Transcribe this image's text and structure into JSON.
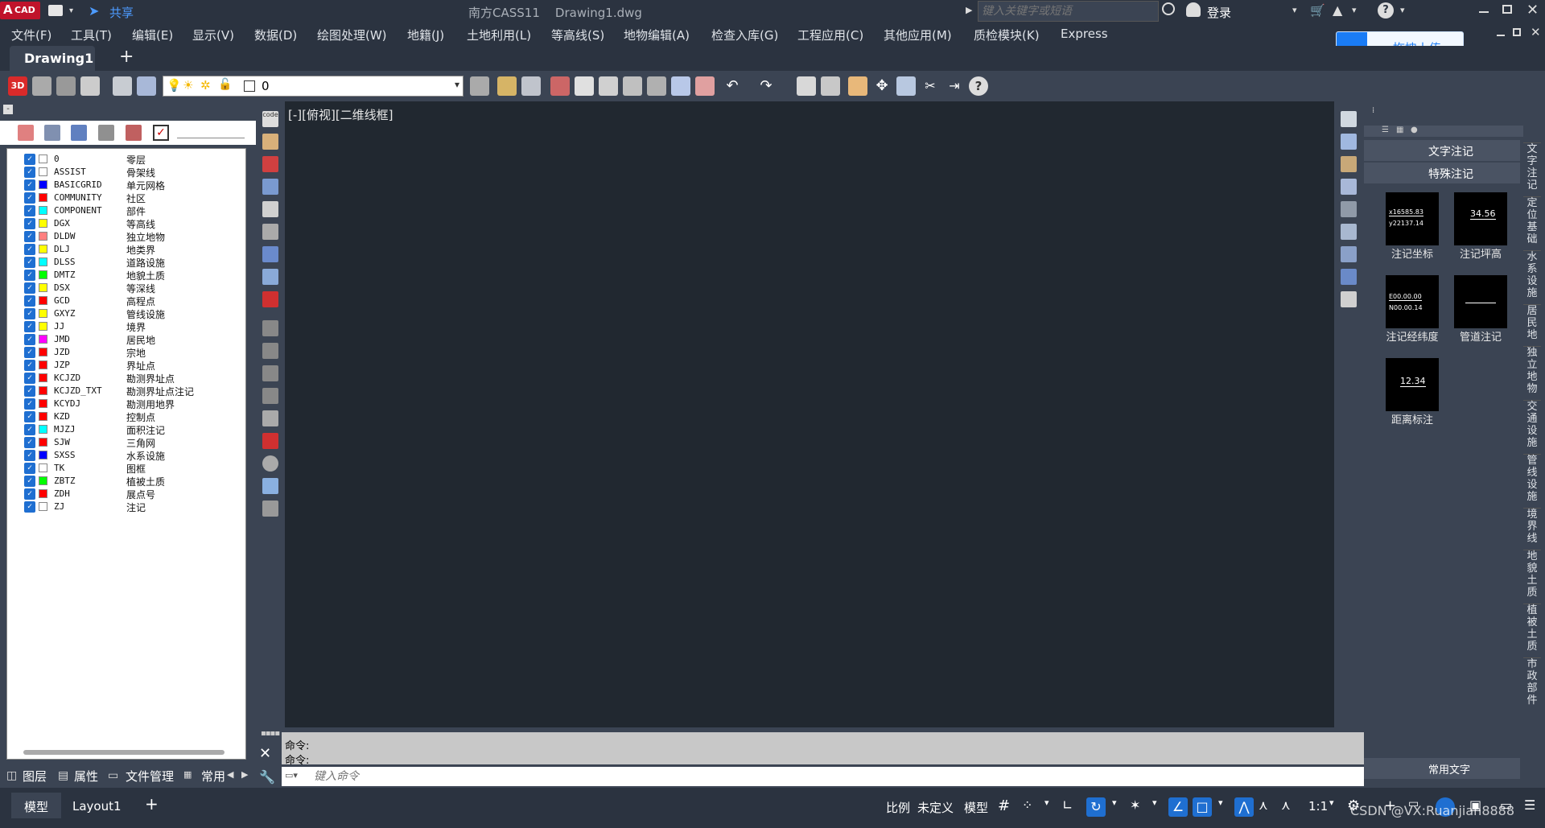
{
  "titlebar": {
    "logo_a": "A",
    "logo_cad": "CAD",
    "share": "共享",
    "title": "南方CASS11    Drawing1.dwg",
    "search_placeholder": "键入关键字或短语",
    "login": "登录"
  },
  "menu": [
    "文件(F)",
    "工具(T)",
    "编辑(E)",
    "显示(V)",
    "数据(D)",
    "绘图处理(W)",
    "地籍(J)",
    "土地利用(L)",
    "等高线(S)",
    "地物编辑(A)",
    "检查入库(G)",
    "工程应用(C)",
    "其他应用(M)",
    "质检模块(K)",
    "Express"
  ],
  "upload_button": "拖拽上传",
  "tabs": {
    "active": "Drawing1",
    "add": "+"
  },
  "toolbar": {
    "layer_value": "0"
  },
  "viewport_label": "[-][俯视][二维线框]",
  "layers": [
    {
      "name": "0",
      "desc": "零层",
      "color": "#ffffff"
    },
    {
      "name": "ASSIST",
      "desc": "骨架线",
      "color": "#ffffff"
    },
    {
      "name": "BASICGRID",
      "desc": "单元网格",
      "color": "#0000ff"
    },
    {
      "name": "COMMUNITY",
      "desc": "社区",
      "color": "#ff0000"
    },
    {
      "name": "COMPONENT",
      "desc": "部件",
      "color": "#00ffff"
    },
    {
      "name": "DGX",
      "desc": "等高线",
      "color": "#ffff00"
    },
    {
      "name": "DLDW",
      "desc": "独立地物",
      "color": "#ff8080"
    },
    {
      "name": "DLJ",
      "desc": "地类界",
      "color": "#ffff00"
    },
    {
      "name": "DLSS",
      "desc": "道路设施",
      "color": "#00ffff"
    },
    {
      "name": "DMTZ",
      "desc": "地貌土质",
      "color": "#00ff00"
    },
    {
      "name": "DSX",
      "desc": "等深线",
      "color": "#ffff00"
    },
    {
      "name": "GCD",
      "desc": "高程点",
      "color": "#ff0000"
    },
    {
      "name": "GXYZ",
      "desc": "管线设施",
      "color": "#ffff00"
    },
    {
      "name": "JJ",
      "desc": "境界",
      "color": "#ffff00"
    },
    {
      "name": "JMD",
      "desc": "居民地",
      "color": "#ff00ff"
    },
    {
      "name": "JZD",
      "desc": "宗地",
      "color": "#ff0000"
    },
    {
      "name": "JZP",
      "desc": "界址点",
      "color": "#ff0000"
    },
    {
      "name": "KCJZD",
      "desc": "勘测界址点",
      "color": "#ff0000"
    },
    {
      "name": "KCJZD_TXT",
      "desc": "勘测界址点注记",
      "color": "#ff0000"
    },
    {
      "name": "KCYDJ",
      "desc": "勘测用地界",
      "color": "#ff0000"
    },
    {
      "name": "KZD",
      "desc": "控制点",
      "color": "#ff0000"
    },
    {
      "name": "MJZJ",
      "desc": "面积注记",
      "color": "#00ffff"
    },
    {
      "name": "SJW",
      "desc": "三角网",
      "color": "#ff0000"
    },
    {
      "name": "SXSS",
      "desc": "水系设施",
      "color": "#0000ff"
    },
    {
      "name": "TK",
      "desc": "图框",
      "color": "#ffffff"
    },
    {
      "name": "ZBTZ",
      "desc": "植被土质",
      "color": "#00ff00"
    },
    {
      "name": "ZDH",
      "desc": "展点号",
      "color": "#ff0000"
    },
    {
      "name": "ZJ",
      "desc": "注记",
      "color": "#ffffff"
    }
  ],
  "left_tabs": [
    "图层",
    "属性",
    "文件管理",
    "常用"
  ],
  "command": {
    "line1": "命令:",
    "line2": "命令:",
    "placeholder": "键入命令"
  },
  "right_panel": {
    "section1": "文字注记",
    "section2": "特殊注记",
    "items": [
      {
        "label": "注记坐标",
        "l1": "x16585.83",
        "l2": "y22137.14"
      },
      {
        "label": "注记坪高",
        "l1": "34.56",
        "l2": ""
      },
      {
        "label": "注记经纬度",
        "l1": "E00.00.00",
        "l2": "N00.00.14"
      },
      {
        "label": "管道注记",
        "l1": "",
        "l2": ""
      },
      {
        "label": "距离标注",
        "l1": "12.34",
        "l2": ""
      }
    ],
    "bottom": "常用文字"
  },
  "side_tabs": [
    "文字注记",
    "定位基础",
    "水系设施",
    "居民地",
    "独立地物",
    "交通设施",
    "管线设施",
    "境界线",
    "地貌土质",
    "植被土质",
    "市政部件"
  ],
  "status": {
    "model_tab": "模型",
    "layout_tab": "Layout1",
    "scale_label": "比例",
    "scale_value": "未定义",
    "model": "模型",
    "ratio": "1:1",
    "watermark": "CSDN @VX:Ruanjian8888"
  },
  "colors": {
    "accent": "#1f6fd1",
    "bg": "#2b3340",
    "panel": "#3b4453",
    "canvas": "#212830"
  }
}
